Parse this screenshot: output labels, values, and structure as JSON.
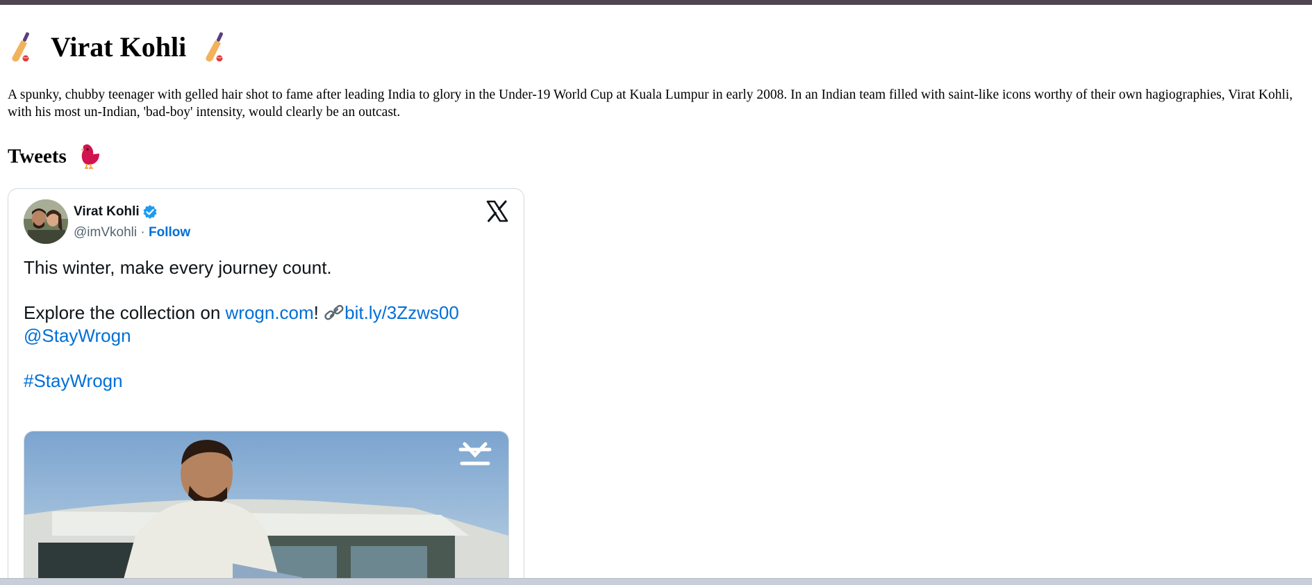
{
  "page": {
    "title": "Virat Kohli",
    "title_icon_left": "cricket-bat-icon",
    "title_icon_right": "cricket-bat-icon",
    "bio": "A spunky, chubby teenager with gelled hair shot to fame after leading India to glory in the Under-19 World Cup at Kuala Lumpur in early 2008. In an Indian team filled with saint-like icons worthy of their own hagiographies, Virat Kohli, with his most un-Indian, 'bad-boy' intensity, would clearly be an outcast.",
    "tweets_heading": "Tweets",
    "tweets_icon": "bird-icon"
  },
  "tweet": {
    "author_name": "Virat Kohli",
    "handle": "@imVkohli",
    "separator": " · ",
    "follow_label": "Follow",
    "line1": "This winter, make every journey count.",
    "line2_prefix": "Explore the collection on ",
    "line2_link1": "wrogn.com",
    "line2_mid": "! ",
    "line2_link2": "bit.ly/3Zzws00",
    "mention": "@StayWrogn",
    "hashtag": "#StayWrogn",
    "brand_icon": "x-logo-icon",
    "media_watermark_icon": "wrogn-logo-icon"
  },
  "colors": {
    "link": "#006fd6",
    "verified": "#1d9bf0",
    "top_bar": "#4f4550"
  }
}
